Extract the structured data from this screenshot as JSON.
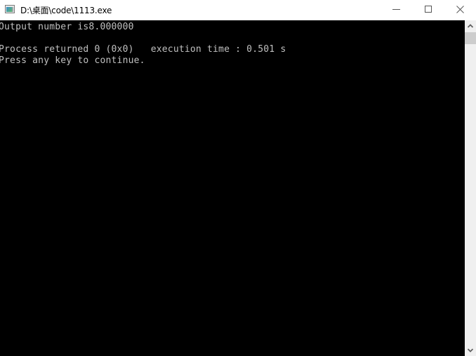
{
  "window": {
    "title": "D:\\桌面\\code\\1113.exe",
    "icon": "console-app-icon",
    "controls": {
      "minimize": "minimize-icon",
      "maximize": "maximize-icon",
      "close": "close-icon"
    }
  },
  "console": {
    "background": "#000000",
    "text_color": "#c0c0c0",
    "lines": [
      "Output number is8.000000",
      "",
      "Process returned 0 (0x0)   execution time : 0.501 s",
      "Press any key to continue."
    ]
  },
  "scrollbar": {
    "up_icon": "chevron-up-icon",
    "down_icon": "chevron-down-icon",
    "position_fraction": 0.0
  }
}
